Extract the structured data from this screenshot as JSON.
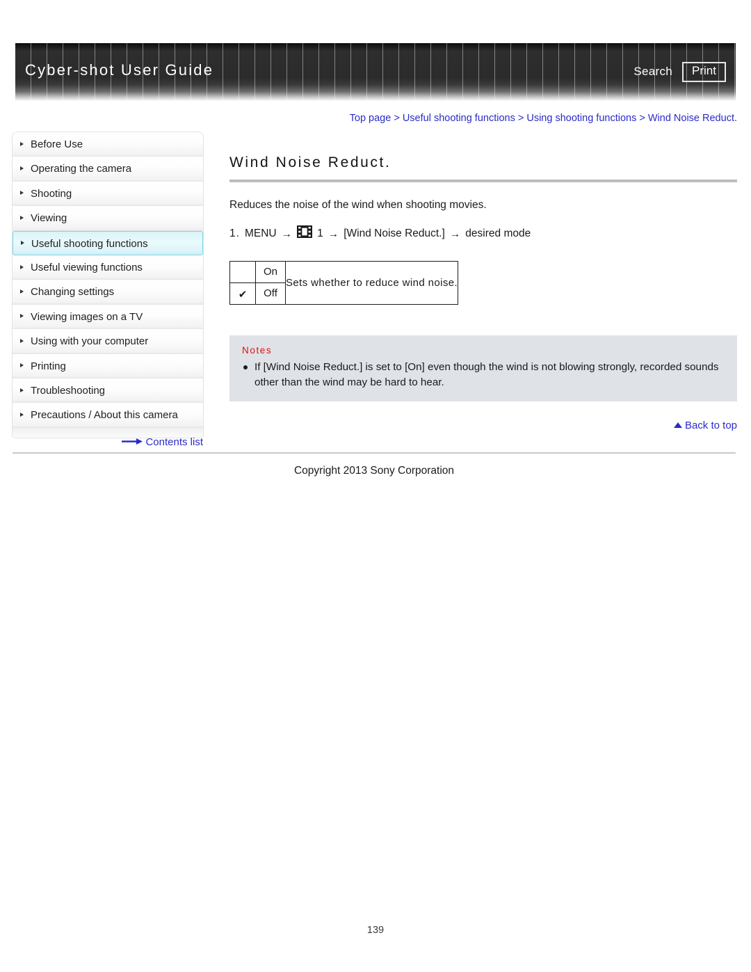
{
  "header": {
    "title": "Cyber-shot User Guide",
    "search_label": "Search",
    "print_label": "Print"
  },
  "breadcrumb": {
    "items": [
      "Top page",
      "Useful shooting functions",
      "Using shooting functions",
      "Wind Noise Reduct."
    ],
    "separator": " > ",
    "text": "Top page > Useful shooting functions > Using shooting functions > Wind Noise Reduct."
  },
  "sidebar": {
    "items": [
      {
        "label": "Before Use",
        "selected": false
      },
      {
        "label": "Operating the camera",
        "selected": false
      },
      {
        "label": "Shooting",
        "selected": false
      },
      {
        "label": "Viewing",
        "selected": false
      },
      {
        "label": "Useful shooting functions",
        "selected": true
      },
      {
        "label": "Useful viewing functions",
        "selected": false
      },
      {
        "label": "Changing settings",
        "selected": false
      },
      {
        "label": "Viewing images on a TV",
        "selected": false
      },
      {
        "label": "Using with your computer",
        "selected": false
      },
      {
        "label": "Printing",
        "selected": false
      },
      {
        "label": "Troubleshooting",
        "selected": false
      },
      {
        "label": "Precautions / About this camera",
        "selected": false
      }
    ],
    "contents_link": "Contents list"
  },
  "main": {
    "title": "Wind Noise Reduct.",
    "intro": "Reduces the noise of the wind when shooting movies.",
    "step": {
      "number": "1.",
      "menu_label": "MENU",
      "icon_name": "film-strip-icon",
      "icon_suffix": "1",
      "setting_label": "[Wind Noise Reduct.]",
      "result_label": "desired mode",
      "arrow": "→"
    },
    "settings_table": {
      "rows": [
        {
          "checked": false,
          "option": "On"
        },
        {
          "checked": true,
          "option": "Off"
        }
      ],
      "description": "Sets whether to reduce wind noise.",
      "check_glyph": "✔"
    },
    "notes": {
      "heading": "Notes",
      "items": [
        "If [Wind Noise Reduct.] is set to [On] even though the wind is not blowing strongly, recorded sounds other than the wind may be hard to hear."
      ]
    },
    "back_to_top": "Back to top"
  },
  "footer": {
    "copyright": "Copyright 2013 Sony Corporation",
    "page_number": "139"
  },
  "colors": {
    "link": "#2b2bc8",
    "notes_heading": "#e01010",
    "notes_background": "#dfe2e7",
    "selected_nav": "#d9f3f8",
    "header_dark": "#2b2b2b"
  }
}
